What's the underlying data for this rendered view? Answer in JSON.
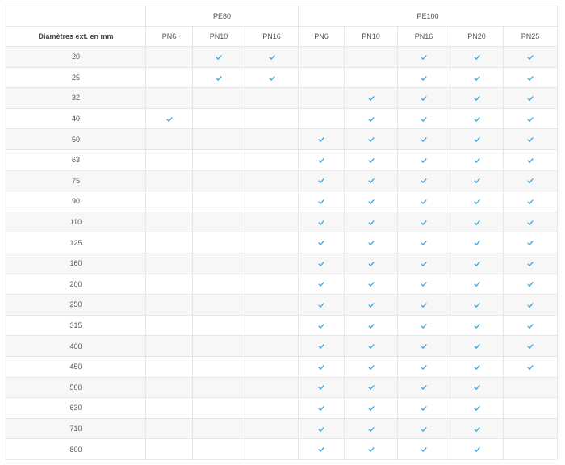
{
  "table": {
    "groups": [
      {
        "label": "PE80",
        "span": 3
      },
      {
        "label": "PE100",
        "span": 5
      }
    ],
    "row_header": "Diamètres ext. en mm",
    "columns": [
      "PN6",
      "PN10",
      "PN16",
      "PN6",
      "PN10",
      "PN16",
      "PN20",
      "PN25"
    ],
    "rows": [
      {
        "d": "20",
        "c": [
          0,
          1,
          1,
          0,
          0,
          1,
          1,
          1
        ]
      },
      {
        "d": "25",
        "c": [
          0,
          1,
          1,
          0,
          0,
          1,
          1,
          1
        ]
      },
      {
        "d": "32",
        "c": [
          0,
          0,
          0,
          0,
          1,
          1,
          1,
          1
        ]
      },
      {
        "d": "40",
        "c": [
          1,
          0,
          0,
          0,
          1,
          1,
          1,
          1
        ]
      },
      {
        "d": "50",
        "c": [
          0,
          0,
          0,
          1,
          1,
          1,
          1,
          1
        ]
      },
      {
        "d": "63",
        "c": [
          0,
          0,
          0,
          1,
          1,
          1,
          1,
          1
        ]
      },
      {
        "d": "75",
        "c": [
          0,
          0,
          0,
          1,
          1,
          1,
          1,
          1
        ]
      },
      {
        "d": "90",
        "c": [
          0,
          0,
          0,
          1,
          1,
          1,
          1,
          1
        ]
      },
      {
        "d": "110",
        "c": [
          0,
          0,
          0,
          1,
          1,
          1,
          1,
          1
        ]
      },
      {
        "d": "125",
        "c": [
          0,
          0,
          0,
          1,
          1,
          1,
          1,
          1
        ]
      },
      {
        "d": "160",
        "c": [
          0,
          0,
          0,
          1,
          1,
          1,
          1,
          1
        ]
      },
      {
        "d": "200",
        "c": [
          0,
          0,
          0,
          1,
          1,
          1,
          1,
          1
        ]
      },
      {
        "d": "250",
        "c": [
          0,
          0,
          0,
          1,
          1,
          1,
          1,
          1
        ]
      },
      {
        "d": "315",
        "c": [
          0,
          0,
          0,
          1,
          1,
          1,
          1,
          1
        ]
      },
      {
        "d": "400",
        "c": [
          0,
          0,
          0,
          1,
          1,
          1,
          1,
          1
        ]
      },
      {
        "d": "450",
        "c": [
          0,
          0,
          0,
          1,
          1,
          1,
          1,
          1
        ]
      },
      {
        "d": "500",
        "c": [
          0,
          0,
          0,
          1,
          1,
          1,
          1,
          0
        ]
      },
      {
        "d": "630",
        "c": [
          0,
          0,
          0,
          1,
          1,
          1,
          1,
          0
        ]
      },
      {
        "d": "710",
        "c": [
          0,
          0,
          0,
          1,
          1,
          1,
          1,
          0
        ]
      },
      {
        "d": "800",
        "c": [
          0,
          0,
          0,
          1,
          1,
          1,
          1,
          0
        ]
      }
    ]
  },
  "check_icon": "checkmark-icon",
  "colors": {
    "check": "#3fa9e0",
    "stripe": "#f7f7f7",
    "border": "#e6e6e6"
  }
}
